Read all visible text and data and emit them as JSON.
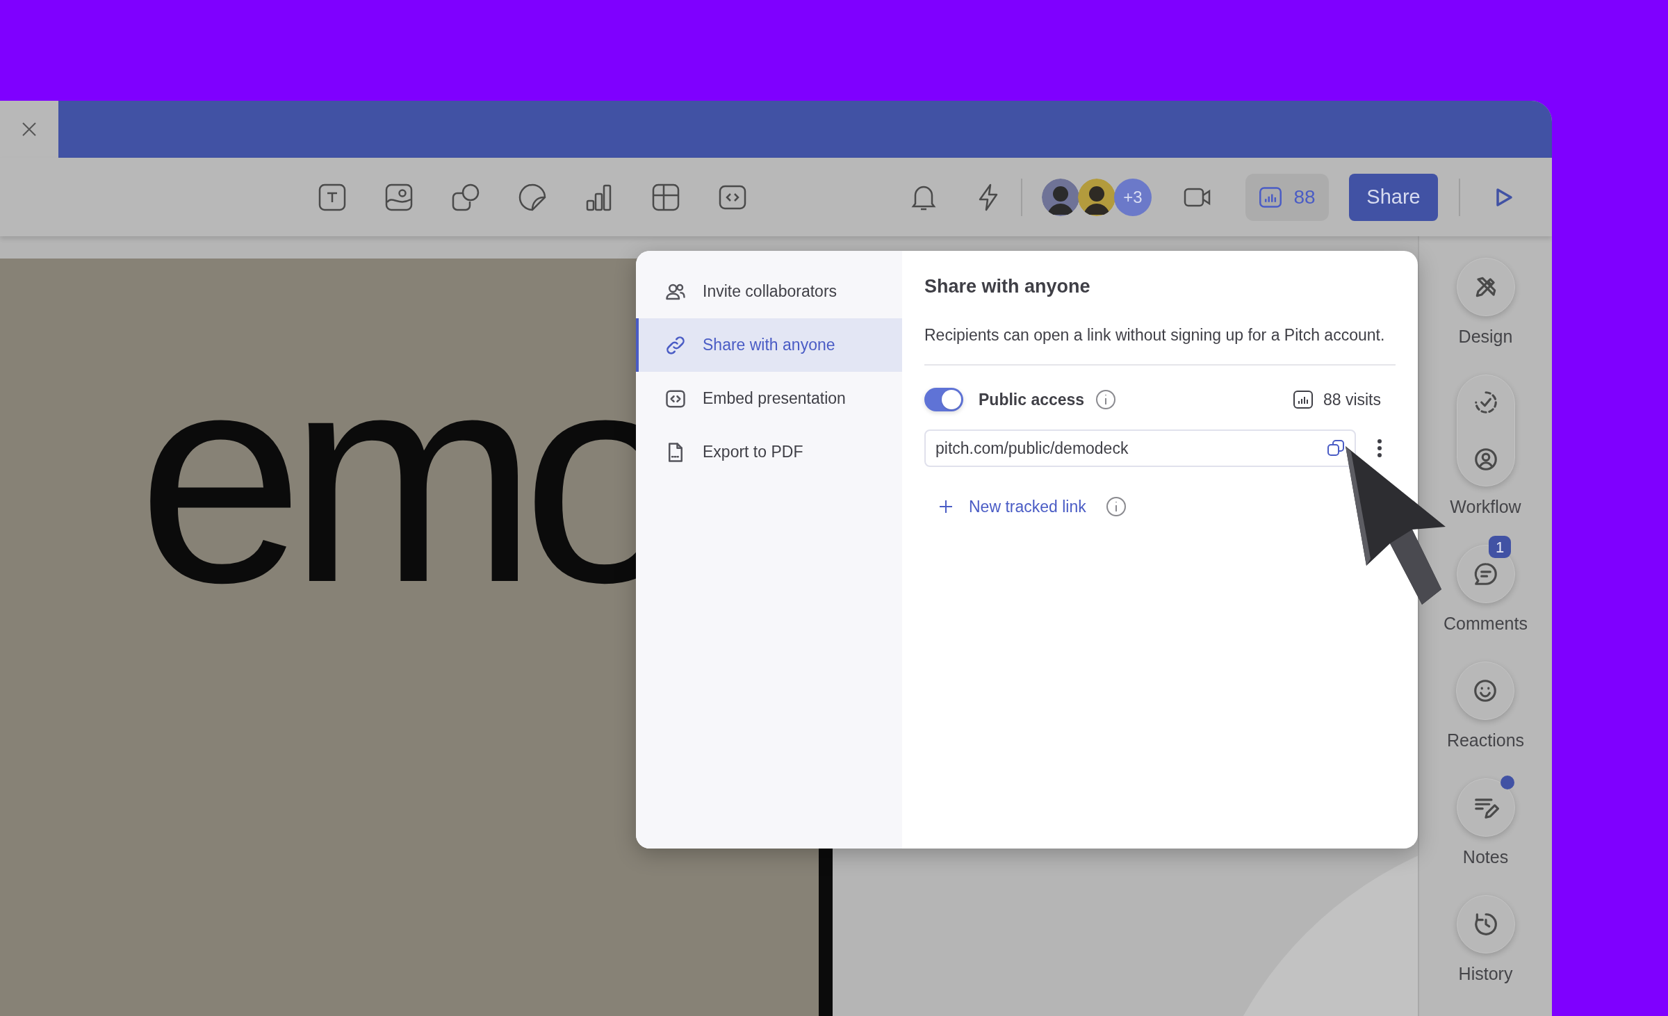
{
  "toolbar": {
    "collaborators_more": "+3",
    "views": "88",
    "share_button": "Share"
  },
  "slide": {
    "title": "emo"
  },
  "share_dialog": {
    "nav": [
      {
        "kind": "people",
        "label": "Invite collaborators",
        "selected": false
      },
      {
        "kind": "link",
        "label": "Share with anyone",
        "selected": true
      },
      {
        "kind": "embed",
        "label": "Embed presentation",
        "selected": false
      },
      {
        "kind": "file",
        "label": "Export to PDF",
        "selected": false
      }
    ],
    "title": "Share with anyone",
    "description": "Recipients can open a link without signing up for a Pitch account.",
    "public_access": {
      "label": "Public access",
      "on": true
    },
    "visits": "88 visits",
    "link": "pitch.com/public/demodeck",
    "new_link": "New tracked link"
  },
  "right_sidebar": [
    {
      "kind": "design",
      "label": "Design",
      "dot": false
    },
    {
      "kind": "workflow",
      "label": "Workflow",
      "dot": false
    },
    {
      "kind": "comments",
      "label": "Comments",
      "badge": "1",
      "dot": false
    },
    {
      "kind": "reactions",
      "label": "Reactions",
      "dot": false
    },
    {
      "kind": "notes",
      "label": "Notes",
      "dot": true
    },
    {
      "kind": "history",
      "label": "History",
      "dot": false
    }
  ]
}
